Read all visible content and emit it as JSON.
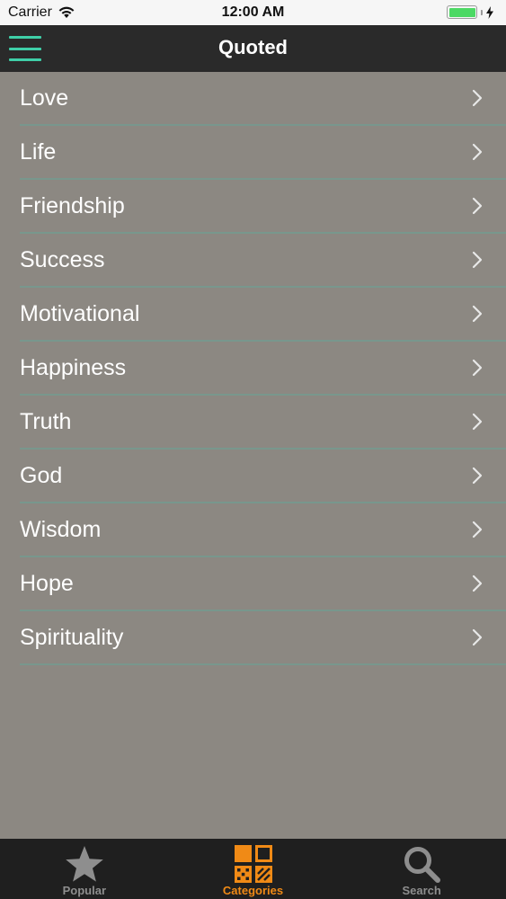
{
  "status_bar": {
    "carrier": "Carrier",
    "time": "12:00 AM",
    "battery_level": 1.0,
    "battery_color": "#4cd964"
  },
  "nav_bar": {
    "title": "Quoted",
    "menu_icon": "hamburger-menu-icon",
    "accent_color": "#3fcfa8"
  },
  "categories": [
    {
      "label": "Love"
    },
    {
      "label": "Life"
    },
    {
      "label": "Friendship"
    },
    {
      "label": "Success"
    },
    {
      "label": "Motivational"
    },
    {
      "label": "Happiness"
    },
    {
      "label": "Truth"
    },
    {
      "label": "God"
    },
    {
      "label": "Wisdom"
    },
    {
      "label": "Hope"
    },
    {
      "label": "Spirituality"
    }
  ],
  "tab_bar": {
    "active_color": "#f08a16",
    "inactive_color": "#8e8e8e",
    "tabs": [
      {
        "label": "Popular",
        "icon": "star-icon",
        "active": false
      },
      {
        "label": "Categories",
        "icon": "categories-grid-icon",
        "active": true
      },
      {
        "label": "Search",
        "icon": "search-icon",
        "active": false
      }
    ]
  }
}
